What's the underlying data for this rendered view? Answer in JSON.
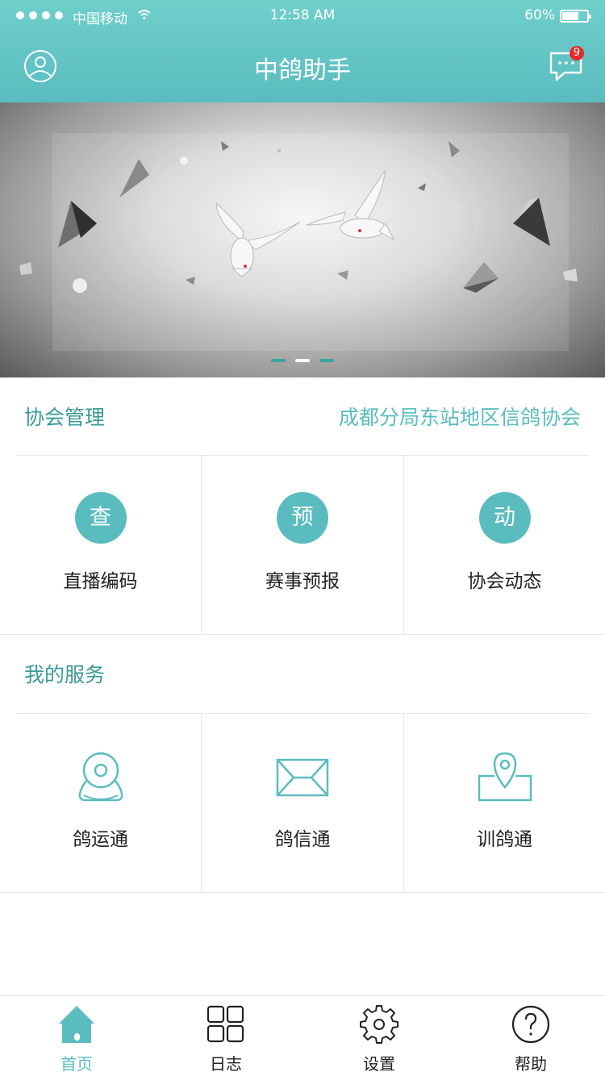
{
  "colors": {
    "accent": "#5bbcc0",
    "header_top": "#6fcfcb",
    "badge": "#e32b2b"
  },
  "status_bar": {
    "carrier": "中国移动",
    "time": "12:58 AM",
    "battery": "60%"
  },
  "nav": {
    "title": "中鸽助手",
    "left_icon": "user-avatar-icon",
    "right_icon": "message-icon",
    "message_badge": "9"
  },
  "banner": {
    "slide_count": 3,
    "active_slide": 2
  },
  "association": {
    "title": "协会管理",
    "org_name": "成都分局东站地区信鸽协会",
    "items": [
      {
        "icon_text": "查",
        "label": "直播编码"
      },
      {
        "icon_text": "预",
        "label": "赛事预报"
      },
      {
        "icon_text": "动",
        "label": "协会动态"
      }
    ]
  },
  "services": {
    "title": "我的服务",
    "items": [
      {
        "icon": "camera-icon",
        "label": "鸽运通"
      },
      {
        "icon": "envelope-icon",
        "label": "鸽信通"
      },
      {
        "icon": "map-pin-icon",
        "label": "训鸽通"
      }
    ]
  },
  "tabbar": {
    "active": 0,
    "tabs": [
      {
        "icon": "home-icon",
        "label": "首页"
      },
      {
        "icon": "grid-icon",
        "label": "日志"
      },
      {
        "icon": "gear-icon",
        "label": "设置"
      },
      {
        "icon": "help-icon",
        "label": "帮助"
      }
    ]
  }
}
